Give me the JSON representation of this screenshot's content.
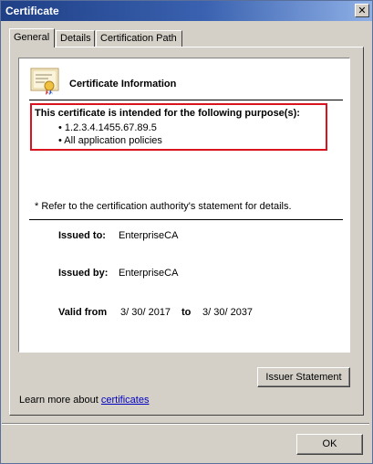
{
  "window": {
    "title": "Certificate",
    "close_label": "✕"
  },
  "tabs": [
    {
      "label": "General",
      "active": true
    },
    {
      "label": "Details",
      "active": false
    },
    {
      "label": "Certification Path",
      "active": false
    }
  ],
  "general": {
    "info_title": "Certificate Information",
    "purpose_heading": "This certificate is intended for the following purpose(s):",
    "purposes": [
      "• 1.2.3.4.1455.67.89.5",
      "• All application policies"
    ],
    "note": "* Refer to the certification authority's statement for details.",
    "issued_to_label": "Issued to:",
    "issued_to_value": "EnterpriseCA",
    "issued_by_label": "Issued by:",
    "issued_by_value": "EnterpriseCA",
    "valid_from_label": "Valid from",
    "valid_from_value": "3/ 30/ 2017",
    "valid_to_label": "to",
    "valid_to_value": "3/ 30/ 2037"
  },
  "buttons": {
    "issuer_statement": "Issuer Statement",
    "ok": "OK"
  },
  "learn_more": {
    "prefix": "Learn more about ",
    "link": "certificates"
  },
  "colors": {
    "highlight_border": "#d9141e",
    "title_bar": "#1f3f86",
    "link": "#0000c0"
  },
  "icons": {
    "certificate": "certificate-icon",
    "close": "close-icon"
  }
}
